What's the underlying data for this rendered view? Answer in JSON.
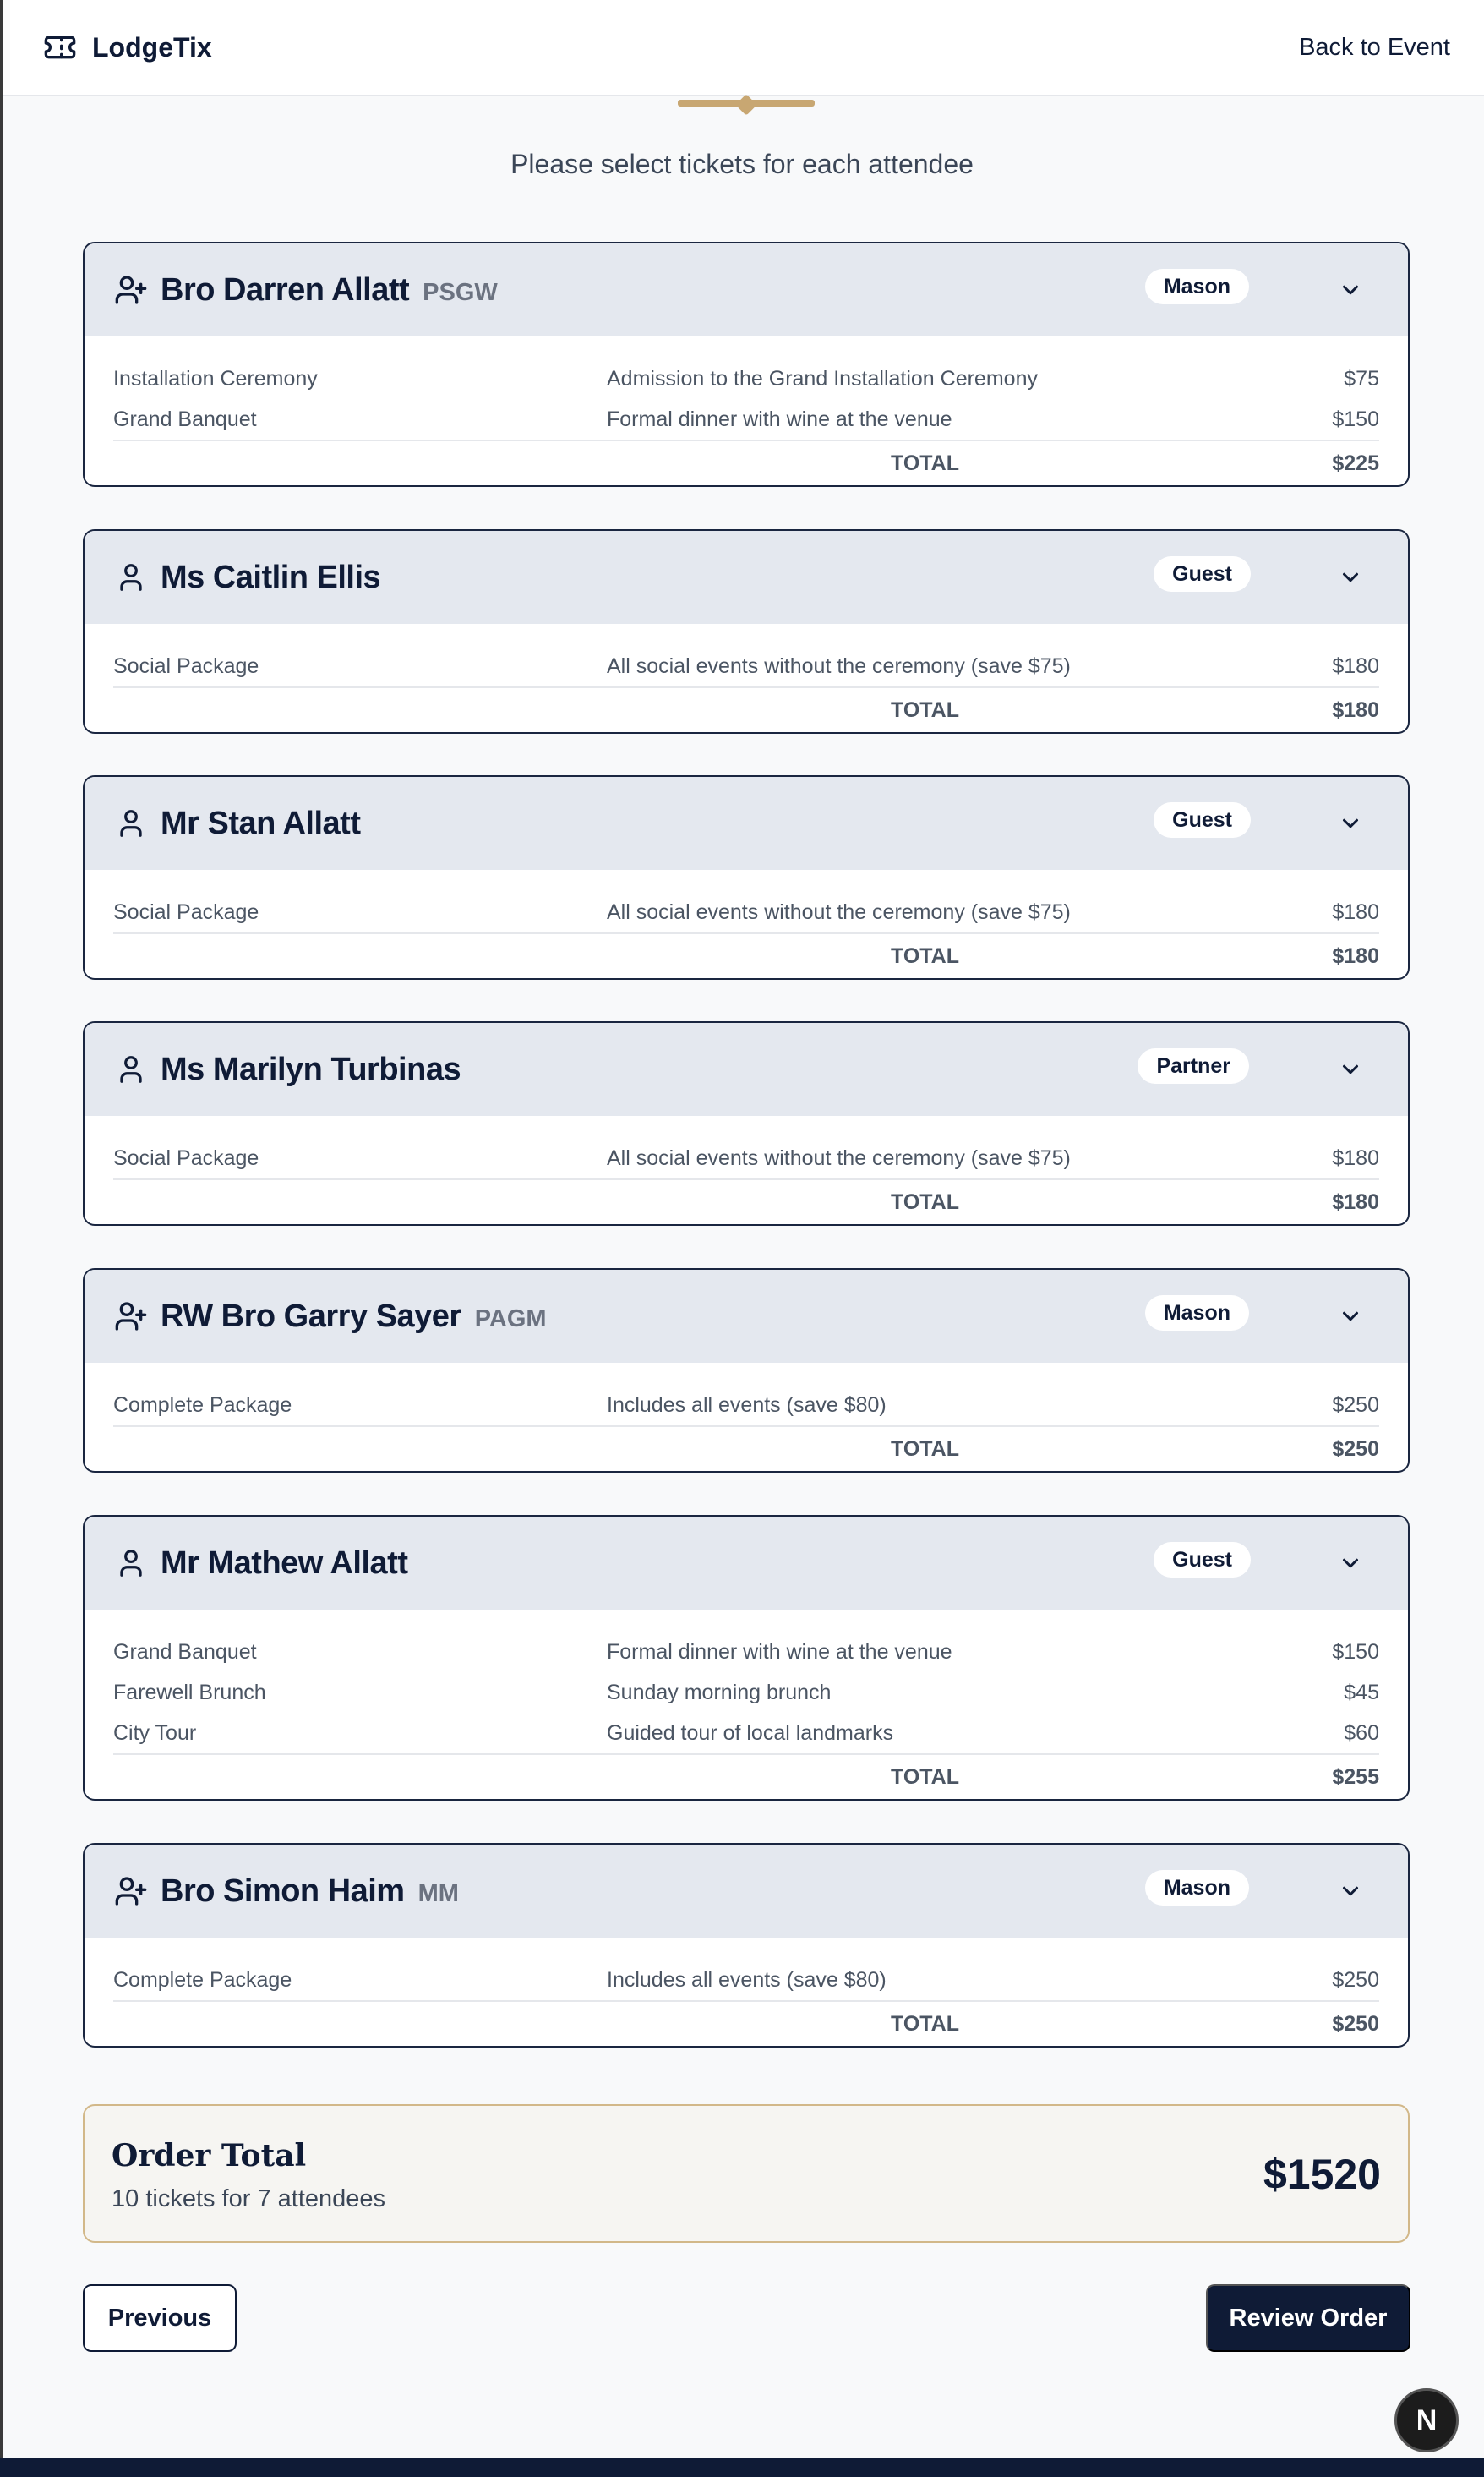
{
  "app": {
    "brand": "LodgeTix",
    "back_link": "Back to Event"
  },
  "step_prompt": "Please select tickets for each attendee",
  "attendees": [
    {
      "name": "Bro Darren Allatt",
      "rank": "PSGW",
      "type": "Mason",
      "icon": "user-plus-icon",
      "tickets": [
        {
          "name": "Installation Ceremony",
          "description": "Admission to the Grand Installation Ceremony",
          "price": "$75"
        },
        {
          "name": "Grand Banquet",
          "description": "Formal dinner with wine at the venue",
          "price": "$150"
        }
      ],
      "total_label": "TOTAL",
      "total": "$225"
    },
    {
      "name": "Ms Caitlin Ellis",
      "rank": "",
      "type": "Guest",
      "icon": "user-icon",
      "tickets": [
        {
          "name": "Social Package",
          "description": "All social events without the ceremony (save $75)",
          "price": "$180"
        }
      ],
      "total_label": "TOTAL",
      "total": "$180"
    },
    {
      "name": "Mr Stan Allatt",
      "rank": "",
      "type": "Guest",
      "icon": "user-icon",
      "tickets": [
        {
          "name": "Social Package",
          "description": "All social events without the ceremony (save $75)",
          "price": "$180"
        }
      ],
      "total_label": "TOTAL",
      "total": "$180"
    },
    {
      "name": "Ms Marilyn Turbinas",
      "rank": "",
      "type": "Partner",
      "icon": "user-icon",
      "tickets": [
        {
          "name": "Social Package",
          "description": "All social events without the ceremony (save $75)",
          "price": "$180"
        }
      ],
      "total_label": "TOTAL",
      "total": "$180"
    },
    {
      "name": "RW Bro Garry Sayer",
      "rank": "PAGM",
      "type": "Mason",
      "icon": "user-plus-icon",
      "tickets": [
        {
          "name": "Complete Package",
          "description": "Includes all events (save $80)",
          "price": "$250"
        }
      ],
      "total_label": "TOTAL",
      "total": "$250"
    },
    {
      "name": "Mr Mathew Allatt",
      "rank": "",
      "type": "Guest",
      "icon": "user-icon",
      "tickets": [
        {
          "name": "Grand Banquet",
          "description": "Formal dinner with wine at the venue",
          "price": "$150"
        },
        {
          "name": "Farewell Brunch",
          "description": "Sunday morning brunch",
          "price": "$45"
        },
        {
          "name": "City Tour",
          "description": "Guided tour of local landmarks",
          "price": "$60"
        }
      ],
      "total_label": "TOTAL",
      "total": "$255"
    },
    {
      "name": "Bro Simon Haim",
      "rank": "MM",
      "type": "Mason",
      "icon": "user-plus-icon",
      "tickets": [
        {
          "name": "Complete Package",
          "description": "Includes all events (save $80)",
          "price": "$250"
        }
      ],
      "total_label": "TOTAL",
      "total": "$250"
    }
  ],
  "order": {
    "title": "Order Total",
    "summary": "10 tickets for 7 attendees",
    "amount": "$1520"
  },
  "actions": {
    "previous": "Previous",
    "review": "Review Order"
  },
  "dev_badge": "N",
  "colors": {
    "navy": "#0f1b36",
    "gold": "#c8a772",
    "card_header": "#e4e8ef"
  }
}
